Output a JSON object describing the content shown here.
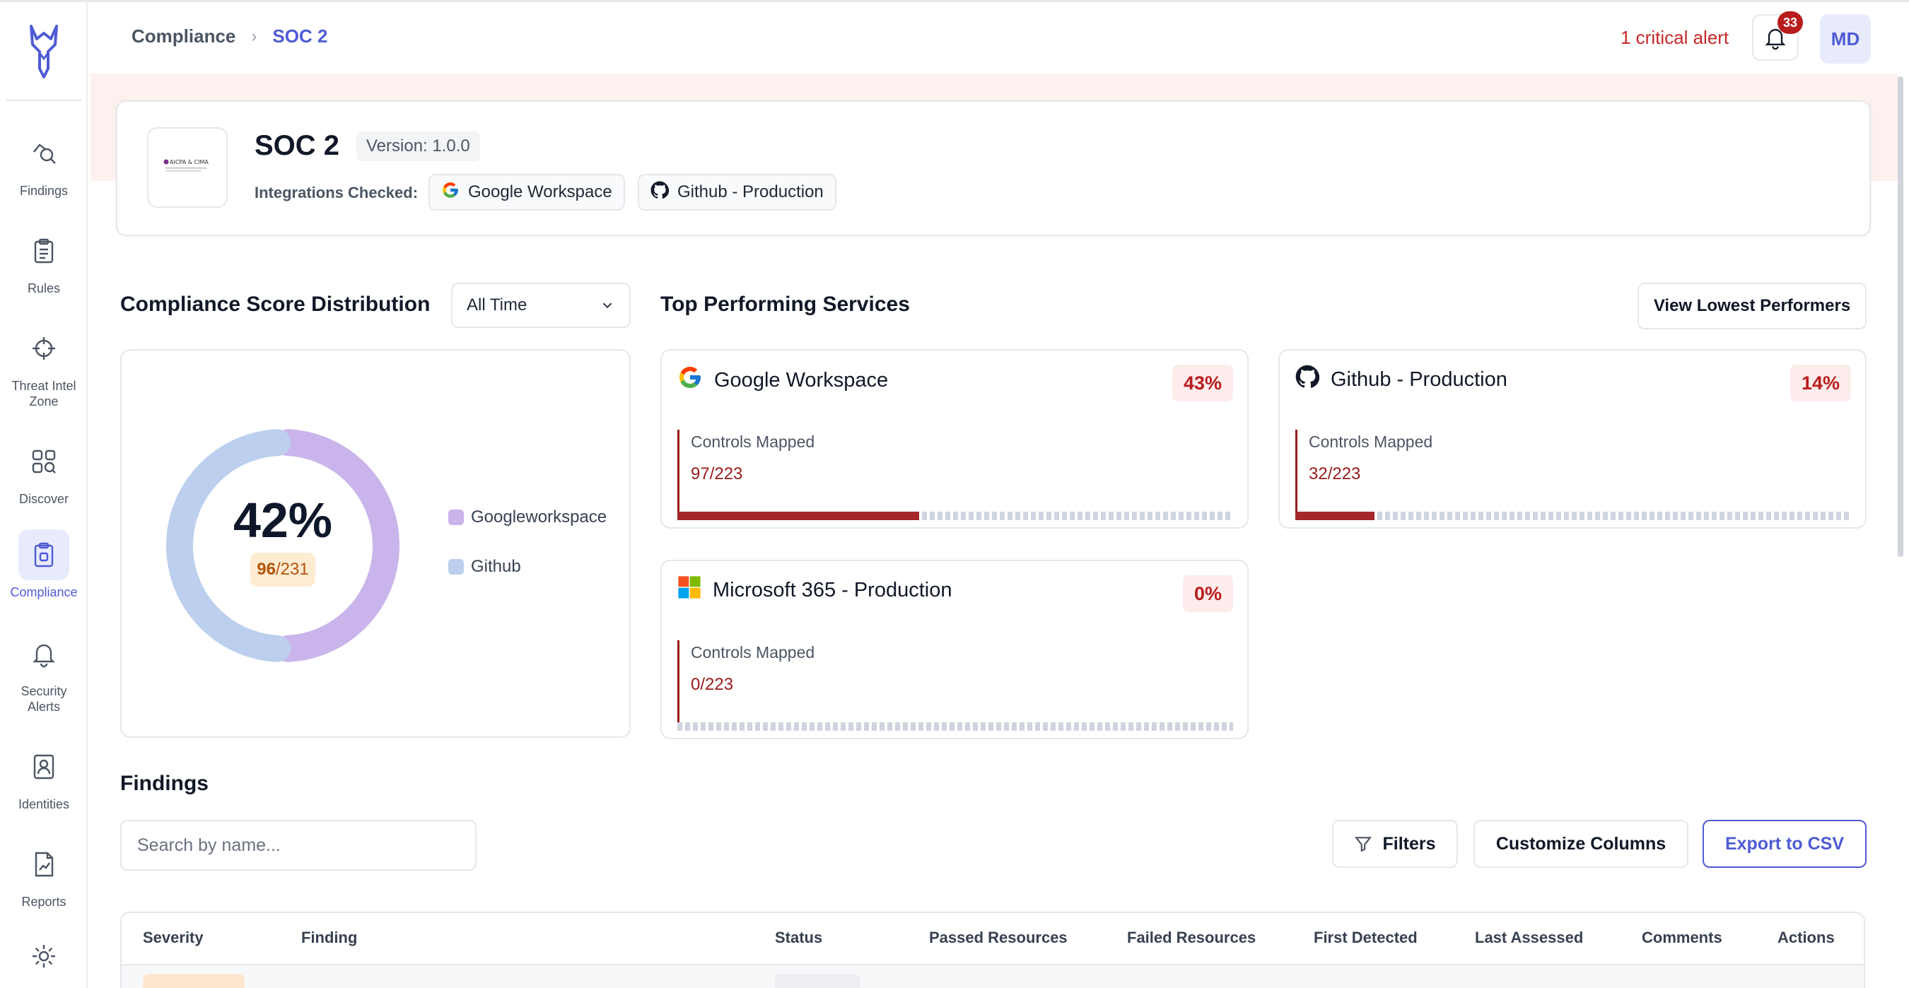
{
  "sidebar": {
    "items": [
      {
        "label": "Findings",
        "icon": "findings-icon"
      },
      {
        "label": "Rules",
        "icon": "clipboard-icon"
      },
      {
        "label": "Threat Intel Zone",
        "icon": "threat-crosshair-icon"
      },
      {
        "label": "Discover",
        "icon": "discover-icon"
      },
      {
        "label": "Compliance",
        "icon": "compliance-icon",
        "active": true
      },
      {
        "label": "Security Alerts",
        "icon": "bell-icon"
      },
      {
        "label": "Identities",
        "icon": "identity-icon"
      },
      {
        "label": "Reports",
        "icon": "reports-icon"
      },
      {
        "label": "",
        "icon": "gear-icon"
      }
    ]
  },
  "header": {
    "breadcrumb": [
      "Compliance",
      "SOC 2"
    ],
    "critical_alert": "1 critical alert",
    "notification_count": "33",
    "avatar_initials": "MD"
  },
  "framework": {
    "logo_text": "AICPA & CIMA",
    "title": "SOC 2",
    "version": "Version: 1.0.0",
    "integrations_label": "Integrations Checked:",
    "integrations": [
      "Google Workspace",
      "Github - Production"
    ]
  },
  "distribution": {
    "title": "Compliance Score Distribution",
    "range": "All Time",
    "score_pct": "42%",
    "score_num": "96",
    "score_den": "/231",
    "legend": [
      {
        "name": "Googleworkspace",
        "color": "#c9b4eb"
      },
      {
        "name": "Github",
        "color": "#bccfee"
      }
    ]
  },
  "chart_data": {
    "type": "pie",
    "categories": [
      "Googleworkspace",
      "Github"
    ],
    "values": [
      50,
      50
    ],
    "colors": [
      "#c9b4eb",
      "#bccfee"
    ],
    "center_label": "42%",
    "center_sublabel": "96/231",
    "legend": "right"
  },
  "top_services": {
    "title": "Top Performing Services",
    "view_lowest_label": "View Lowest Performers",
    "services": [
      {
        "name": "Google Workspace",
        "pct": "43%",
        "mapped_label": "Controls Mapped",
        "mapped": "97/223",
        "fraction": 0.435,
        "logo": "google-logo-icon"
      },
      {
        "name": "Github - Production",
        "pct": "14%",
        "mapped_label": "Controls Mapped",
        "mapped": "32/223",
        "fraction": 0.143,
        "logo": "github-logo-icon"
      },
      {
        "name": "Microsoft 365 - Production",
        "pct": "0%",
        "mapped_label": "Controls Mapped",
        "mapped": "0/223",
        "fraction": 0,
        "logo": "microsoft-logo-icon"
      }
    ]
  },
  "findings": {
    "title": "Findings",
    "search_placeholder": "Search by name...",
    "filters_label": "Filters",
    "customize_label": "Customize Columns",
    "export_label": "Export to CSV",
    "columns": [
      "Severity",
      "Finding",
      "Status",
      "Passed Resources",
      "Failed Resources",
      "First Detected",
      "Last Assessed",
      "Comments",
      "Actions"
    ]
  },
  "colors": {
    "accent": "#4f5bd5",
    "critical": "#c62828",
    "bar_fill": "#a4282a"
  }
}
